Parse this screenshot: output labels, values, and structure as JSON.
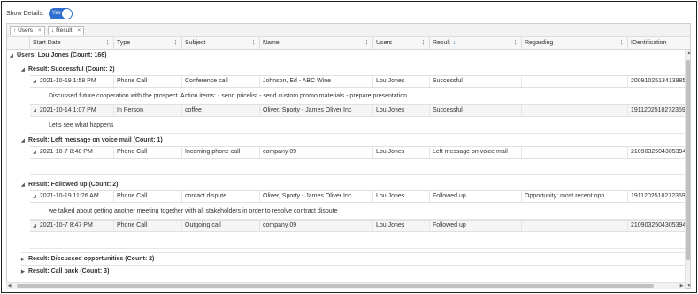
{
  "toolbar": {
    "show_details_label": "Show Details:",
    "toggle_label": "Yes"
  },
  "groupby": {
    "chips": [
      {
        "arrow": "↑",
        "label": "Users",
        "close": "×"
      },
      {
        "arrow": "↓",
        "label": "Result",
        "close": "×"
      }
    ]
  },
  "columns": [
    {
      "label": "Start Date",
      "sort": ""
    },
    {
      "label": "Type",
      "sort": ""
    },
    {
      "label": "Subject",
      "sort": ""
    },
    {
      "label": "Name",
      "sort": ""
    },
    {
      "label": "Users",
      "sort": ""
    },
    {
      "label": "Result",
      "sort": "↓"
    },
    {
      "label": "Regarding",
      "sort": ""
    },
    {
      "label": "IDentification",
      "sort": ""
    }
  ],
  "groups": {
    "user": "Users: Lou Jones (Count: 166)",
    "g1": "Result: Successful (Count: 2)",
    "g2": "Result: Left message on voice mail (Count: 1)",
    "g3": "Result: Followed up (Count: 2)",
    "g4": "Result: Discussed opportunities (Count: 2)",
    "g5": "Result: Call back (Count: 3)"
  },
  "rows": [
    {
      "start": "2021-10-19 1:58 PM",
      "type": "Phone Call",
      "subject": "Conference call",
      "name": "Johnson, Ed - ABC Wine",
      "users": "Lou Jones",
      "result": "Successful",
      "regarding": "",
      "id": "20091025134138853",
      "detail": "Discussed future cooperation with the prospect. Action items: - send pricelist - send custom promo materials - prepare presentation"
    },
    {
      "start": "2021-10-14 1:07 PM",
      "type": "In Person",
      "subject": "coffee",
      "name": "Oliver, Sporty - James Oliver Inc",
      "users": "Lou Jones",
      "result": "Successful",
      "regarding": "",
      "id": "19112025102723598",
      "detail": "Let's see what happens"
    },
    {
      "start": "2021-10-7 8:48 PM",
      "type": "Phone Call",
      "subject": "Incoming phone call",
      "name": "company 09",
      "users": "Lou Jones",
      "result": "Left message on voice mail",
      "regarding": "",
      "id": "21090325043053949",
      "detail": ""
    },
    {
      "start": "2021-10-19 11:26 AM",
      "type": "Phone Call",
      "subject": "contact dispute",
      "name": "Oliver, Sporty - James Oliver Inc",
      "users": "Lou Jones",
      "result": "Followed up",
      "regarding": "Opportunity: most recent opp",
      "id": "19112025102723598",
      "detail": "we talked about getting another meeting together with all stakeholders in order to resolve contract dispute"
    },
    {
      "start": "2021-10-7 8:47 PM",
      "type": "Phone Call",
      "subject": "Outgoing call",
      "name": "company 09",
      "users": "Lou Jones",
      "result": "Followed up",
      "regarding": "",
      "id": "21090325043053949",
      "detail": ""
    }
  ]
}
